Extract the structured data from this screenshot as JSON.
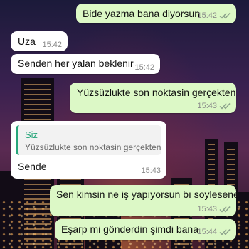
{
  "theme": {
    "outgoing_bubble_color": "#dcf8c6",
    "incoming_bubble_color": "#ffffff",
    "quote_accent_color": "#27a67a",
    "read_ticks_color": "#8aa08a"
  },
  "messages": [
    {
      "direction": "outgoing",
      "text": "Bide yazma bana diyorsun",
      "time": "15:42",
      "status": "read-double-check"
    },
    {
      "direction": "incoming",
      "text": "Uza",
      "time": "15:42"
    },
    {
      "direction": "incoming",
      "text": "Senden her yalan beklenir",
      "time": "15:42"
    },
    {
      "direction": "outgoing",
      "text": "Yüzsüzlukte son noktasin gerçekten",
      "time": "15:43",
      "status": "read-double-check"
    },
    {
      "direction": "incoming",
      "text": "Sende",
      "time": "15:43",
      "quote": {
        "author": "Siz",
        "text": "Yüzsüzlukte son noktasin gerçekten"
      }
    },
    {
      "direction": "outgoing",
      "text": "Sen kimsin ne iş yapıyorsun bı soylesene",
      "time": "15:43",
      "status": "read-double-check"
    },
    {
      "direction": "outgoing",
      "text": "Eşarp mi gönderdin şimdi bana",
      "time": "15:44",
      "status": "read-double-check"
    }
  ]
}
